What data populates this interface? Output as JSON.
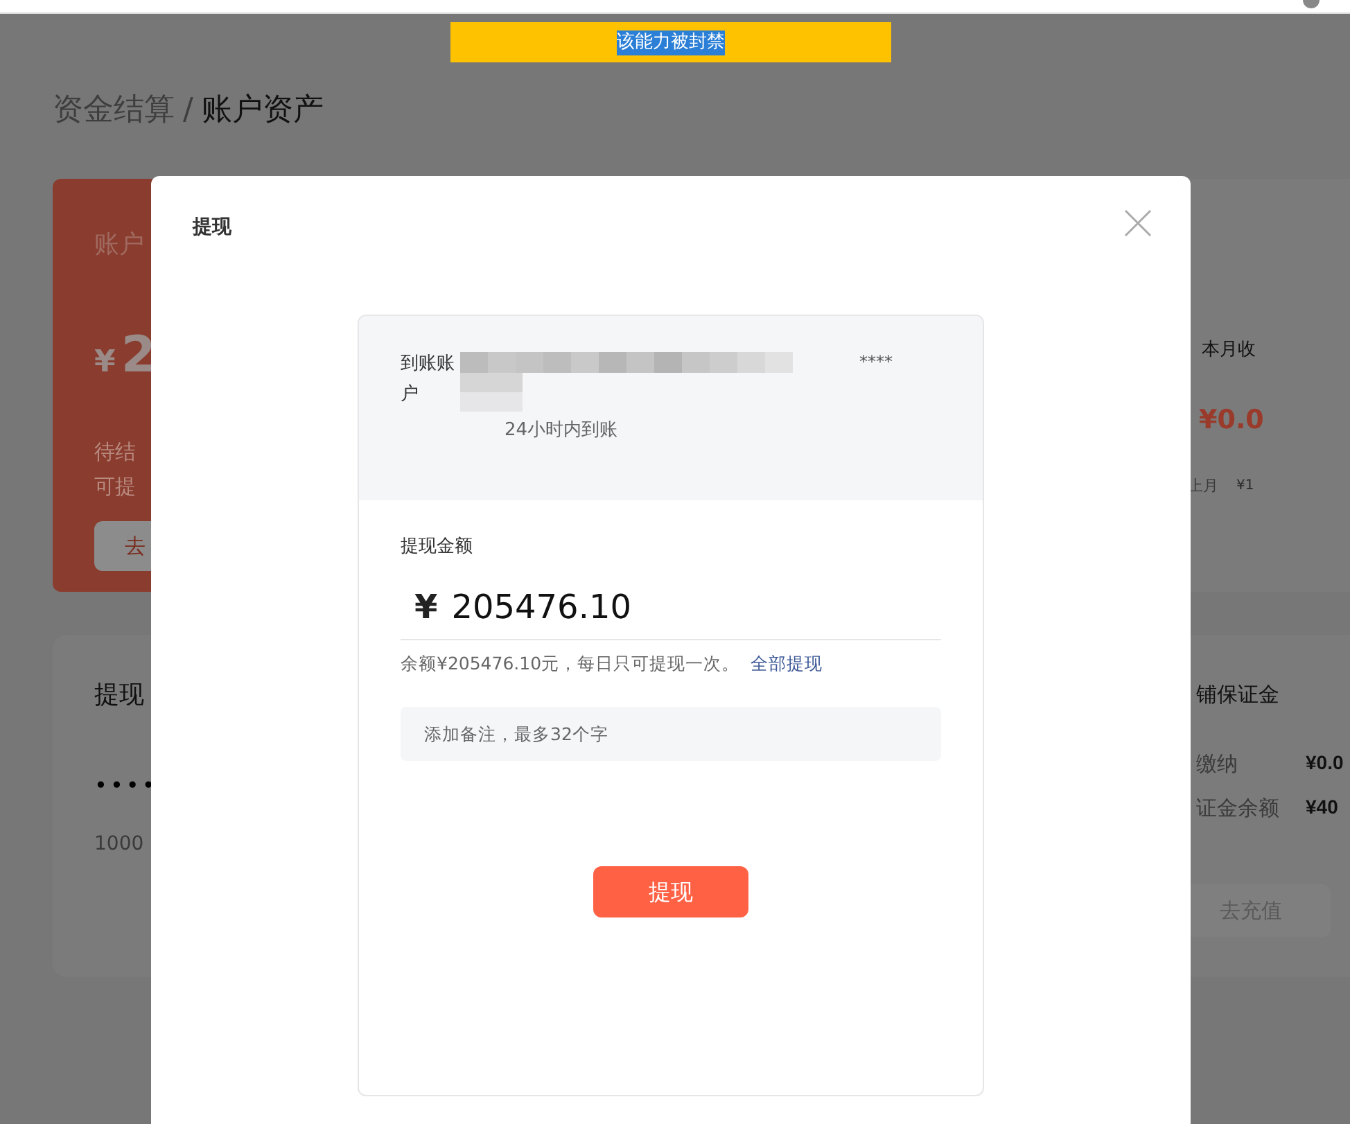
{
  "banner": {
    "text": "该能力被封禁"
  },
  "breadcrumb": {
    "parent": "资金结算",
    "separator": "/",
    "current": "账户资产"
  },
  "balance_card": {
    "title": "账户",
    "currency": "¥",
    "amount": "2",
    "lines": [
      "待结",
      "可提"
    ],
    "button": "去"
  },
  "income_card": {
    "title": "本月收",
    "amount": "¥0.0",
    "last_month_label": "上月",
    "last_month_value": "¥1"
  },
  "withdraw_account_card": {
    "title": "提现",
    "masked": "••••",
    "number": "1000"
  },
  "deposit_card": {
    "title": "铺保证金",
    "rows": [
      {
        "label": "缴纳",
        "value": "¥0.0"
      },
      {
        "label": "证金余额",
        "value": "¥40"
      }
    ],
    "button": "去充值"
  },
  "dialog": {
    "title": "提现",
    "account_label": "到账账户",
    "account_suffix": "****",
    "arrival_note": "24小时内到账",
    "amount_label": "提现金额",
    "currency": "¥",
    "amount": "205476.10",
    "balance_note": "余额¥205476.10元，每日只可提现一次。",
    "withdraw_all_link": "全部提现",
    "remark_placeholder": "添加备注，最多32个字",
    "submit_button": "提现"
  }
}
